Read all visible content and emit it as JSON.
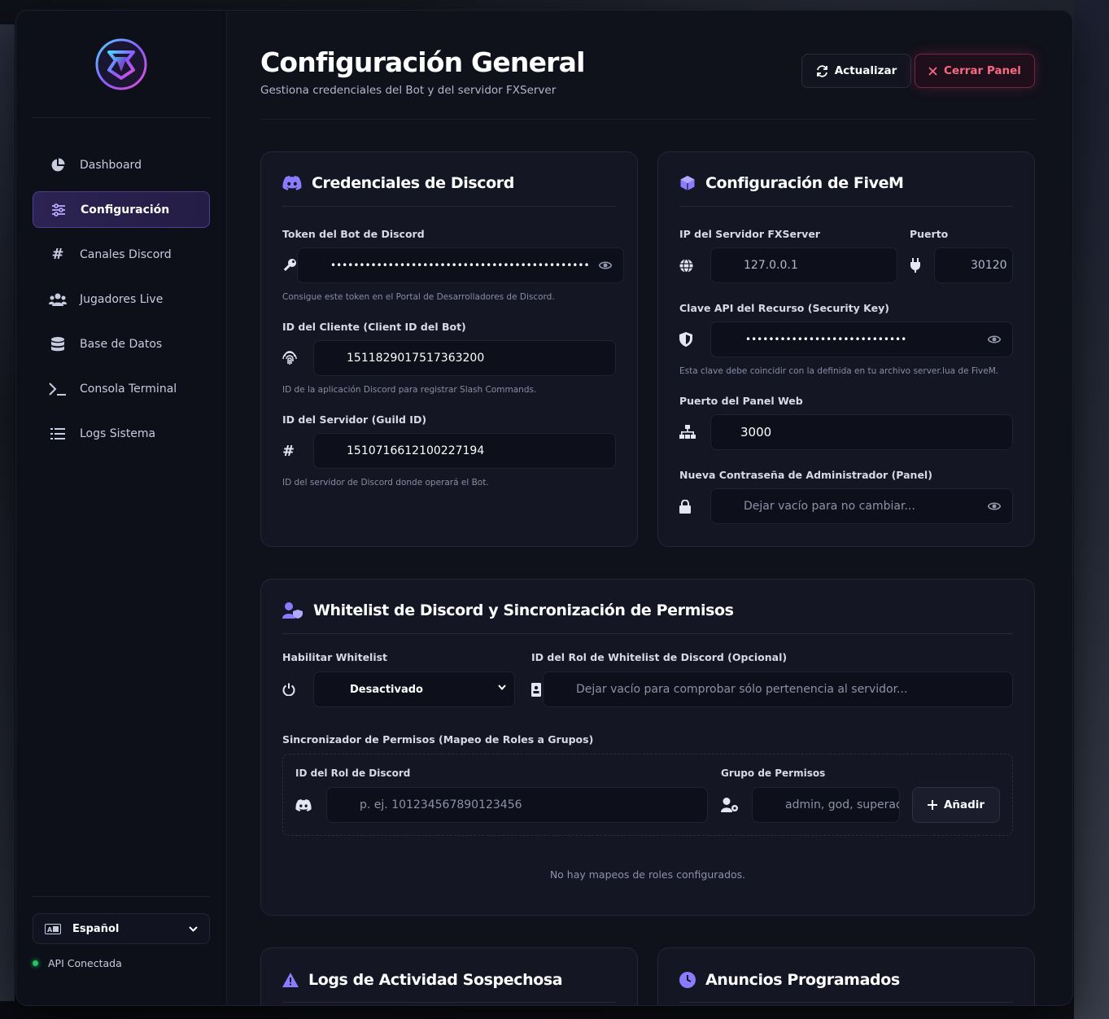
{
  "app": {
    "title": "Configuración General",
    "subtitle": "Gestiona credenciales del Bot y del servidor FXServer"
  },
  "toolbar": {
    "refresh_label": "Actualizar",
    "close_label": "Cerrar Panel"
  },
  "colors": {
    "accent": "#7c5cff",
    "danger": "#f56b84",
    "success": "#22c55e",
    "background": "#0f111b"
  },
  "sidebar": {
    "items": [
      {
        "label": "Dashboard",
        "icon": "chart-pie-icon"
      },
      {
        "label": "Configuración",
        "icon": "sliders-icon",
        "active": true
      },
      {
        "label": "Canales Discord",
        "icon": "hashtag-icon"
      },
      {
        "label": "Jugadores Live",
        "icon": "users-icon"
      },
      {
        "label": "Base de Datos",
        "icon": "database-icon"
      },
      {
        "label": "Consola Terminal",
        "icon": "terminal-icon"
      },
      {
        "label": "Logs Sistema",
        "icon": "list-icon"
      }
    ],
    "language": "Español",
    "api_status": "API Conectada"
  },
  "discord_card": {
    "title": "Credenciales de Discord",
    "token_label": "Token del Bot de Discord",
    "token_value": "•••••••••••••••••••••••••••••••••••••••••••••••••••••••••••••••••••••••",
    "token_hint": "Consigue este token en el Portal de Desarrolladores de Discord.",
    "client_id_label": "ID del Cliente (Client ID del Bot)",
    "client_id_value": "1511829017517363200",
    "client_id_hint": "ID de la aplicación Discord para registrar Slash Commands.",
    "guild_id_label": "ID del Servidor (Guild ID)",
    "guild_id_value": "1510716612100227194",
    "guild_id_hint": "ID del servidor de Discord donde operará el Bot."
  },
  "fivem_card": {
    "title": "Configuración de FiveM",
    "ip_label": "IP del Servidor FXServer",
    "ip_value": "127.0.0.1",
    "port_label": "Puerto",
    "port_value": "30120",
    "api_key_label": "Clave API del Recurso (Security Key)",
    "api_key_value": "••••••••••••••••••••••••••••",
    "api_key_hint": "Esta clave debe coincidir con la definida en tu archivo server.lua de FiveM.",
    "web_port_label": "Puerto del Panel Web",
    "web_port_value": "3000",
    "admin_pw_label": "Nueva Contraseña de Administrador (Panel)",
    "admin_pw_placeholder": "Dejar vacío para no cambiar..."
  },
  "whitelist_card": {
    "title": "Whitelist de Discord y Sincronización de Permisos",
    "enable_label": "Habilitar Whitelist",
    "enable_value": "Desactivado",
    "role_id_label": "ID del Rol de Whitelist de Discord (Opcional)",
    "role_id_placeholder": "Dejar vacío para comprobar sólo pertenencia al servidor...",
    "sync_label": "Sincronizador de Permisos (Mapeo de Roles a Grupos)",
    "discord_role_label": "ID del Rol de Discord",
    "discord_role_placeholder": "p. ej. 101234567890123456",
    "group_label": "Grupo de Permisos",
    "group_placeholder": "admin, god, superadmin",
    "add_label": "Añadir",
    "empty_message": "No hay mapeos de roles configurados."
  },
  "logs_card": {
    "title": "Logs de Actividad Sospechosa"
  },
  "announcements_card": {
    "title": "Anuncios Programados"
  }
}
